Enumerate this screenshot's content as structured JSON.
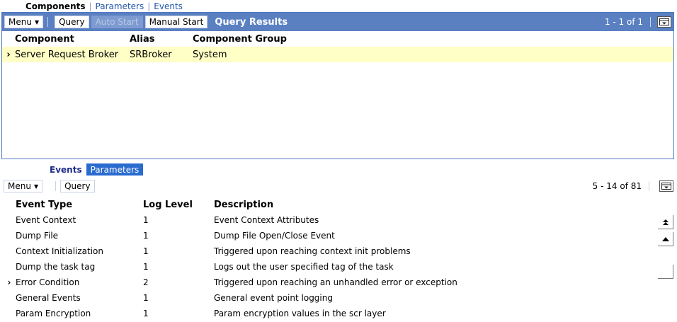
{
  "top_tabs": {
    "active": "Components",
    "links": [
      "Parameters",
      "Events"
    ]
  },
  "top_applet": {
    "toolbar": {
      "menu_label": "Menu",
      "query_label": "Query",
      "auto_start_label": "Auto Start",
      "manual_start_label": "Manual Start",
      "title": "Query Results",
      "record_counter": "1 - 1 of 1"
    },
    "columns": [
      "Component",
      "Alias",
      "Component Group"
    ],
    "rows": [
      {
        "component": "Server Request Broker",
        "alias": "SRBroker",
        "group": "System",
        "selected": true
      }
    ]
  },
  "bottom_tabs": {
    "events_label": "Events",
    "parameters_label": "Parameters"
  },
  "bottom_applet": {
    "toolbar": {
      "menu_label": "Menu",
      "query_label": "Query",
      "record_counter": "5 - 14 of 81"
    },
    "columns": [
      "Event Type",
      "Log Level",
      "Description"
    ],
    "rows": [
      {
        "type": "Event Context",
        "level": "1",
        "desc": "Event Context Attributes"
      },
      {
        "type": "Dump File",
        "level": "1",
        "desc": "Dump File Open/Close Event"
      },
      {
        "type": "Context Initialization",
        "level": "1",
        "desc": "Triggered upon reaching context init problems"
      },
      {
        "type": "Dump the task tag",
        "level": "1",
        "desc": "Logs out the user specified tag of the task"
      },
      {
        "type": "Error Condition",
        "level": "2",
        "desc": "Triggered upon reaching an unhandled error or exception"
      },
      {
        "type": "General Events",
        "level": "1",
        "desc": "General event point logging"
      },
      {
        "type": "Param Encryption",
        "level": "1",
        "desc": "Param encryption values in the scr layer"
      }
    ]
  },
  "colors": {
    "toolbar_blue": "#5a80c2",
    "selected_row": "#ffffc6",
    "active_tab": "#2a6bd0"
  }
}
